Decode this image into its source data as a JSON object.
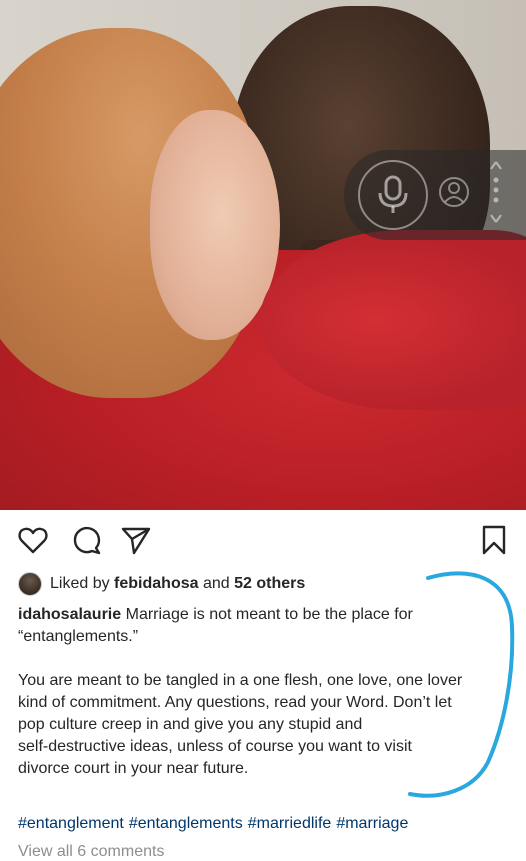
{
  "post": {
    "likes": {
      "prefix": "Liked by",
      "user": "febidahosa",
      "conjunction": "and",
      "others": "52 others"
    },
    "caption": {
      "username": "idahosalaurie",
      "line1": "Marriage is not meant to be the place for",
      "line2": "“entanglements.”",
      "paragraph2": [
        "You are meant to be tangled in a one flesh, one love, one lover",
        "kind of commitment. Any questions, read your Word. Don’t let",
        "pop culture creep in and give you any stupid and",
        "self-destructive ideas, unless of course you want to visit",
        "divorce court in your near future."
      ]
    },
    "hashtags": [
      "#entanglement",
      "#entanglements",
      "#marriedlife",
      "#marriage"
    ],
    "view_comments": "View all 6 comments"
  },
  "icons": {
    "like": "heart-icon",
    "comment": "comment-icon",
    "share": "share-icon",
    "save": "bookmark-icon",
    "voice": "microphone-icon",
    "voice_person": "person-icon",
    "more": "more-vertical-icon"
  },
  "colors": {
    "hashtag": "#00376b",
    "muted": "#8e8e8e",
    "annotation": "#29a8e0"
  }
}
